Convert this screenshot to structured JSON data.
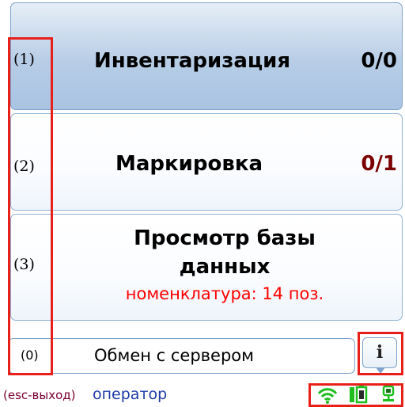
{
  "menu": {
    "items": [
      {
        "number": "(1)",
        "title": "Инвентаризация",
        "count": "0/0",
        "selected": true
      },
      {
        "number": "(2)",
        "title": "Маркировка",
        "count": "0/1",
        "count_color": "#7b0000"
      },
      {
        "number": "(3)",
        "title_line1": "Просмотр базы",
        "title_line2": "данных",
        "subtitle": "номенклатура: 14 поз."
      }
    ]
  },
  "server": {
    "number": "(0)",
    "label": "Обмен с сервером"
  },
  "info_button": {
    "glyph": "i"
  },
  "status_bar": {
    "exit_hint": "(esc-выход)",
    "user": "оператор",
    "icons": [
      "wifi-icon",
      "battery-icon",
      "network-icon"
    ]
  },
  "colors": {
    "accent_blue": "#a9c3e2",
    "border_blue": "#7ea2cb",
    "count_dark_red": "#7b0000",
    "subtitle_red": "#ff0000",
    "status_green": "#1fbf1f",
    "annotation_red": "#e8201a"
  }
}
